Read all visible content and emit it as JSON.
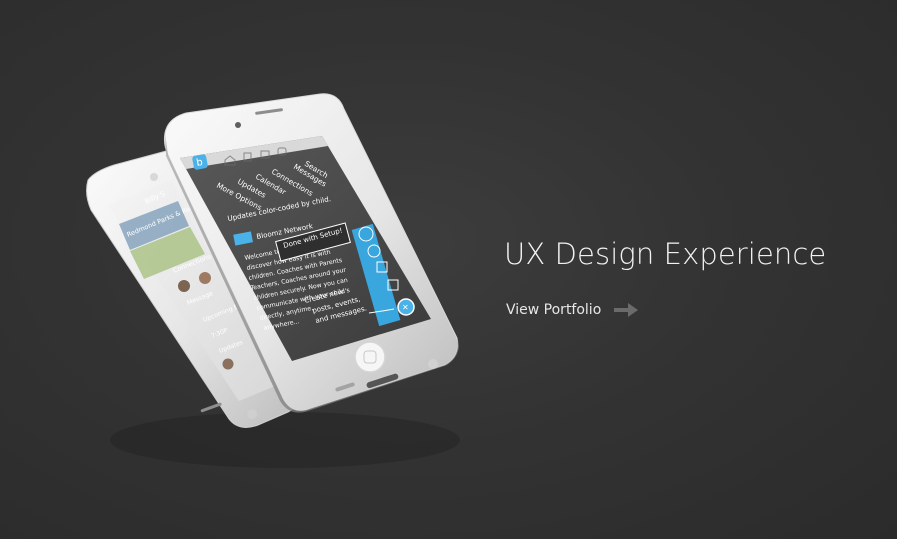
{
  "hero": {
    "title": "UX Design Experience",
    "link_label": "View Portfolio"
  },
  "front_phone": {
    "nav_items": [
      "Search",
      "Messages",
      "Connections",
      "Calendar",
      "Updates",
      "More Options"
    ],
    "updates_note": "Updates color-coded by child.",
    "network_name": "Bloomz Network",
    "welcome_text": [
      "Welcome to Bloomz!",
      "discover how easy it is with",
      "children. Coaches with Parents",
      "Teachers, Coaches around your",
      "children securely. Now you can",
      "communicate with your child's",
      "directly, anytime,",
      "anywhere..."
    ],
    "setup_button": "Done with Setup!",
    "create_hint": [
      "Create new",
      "posts, events,",
      "and messages."
    ]
  },
  "back_phone": {
    "header": "Billy S",
    "map_label": "Redmond Parks & Rec",
    "connections_label": "Connections",
    "message_label": "Message",
    "upcoming_label": "Upcoming E",
    "time_label": "7:30P",
    "updates_label": "Updates"
  }
}
